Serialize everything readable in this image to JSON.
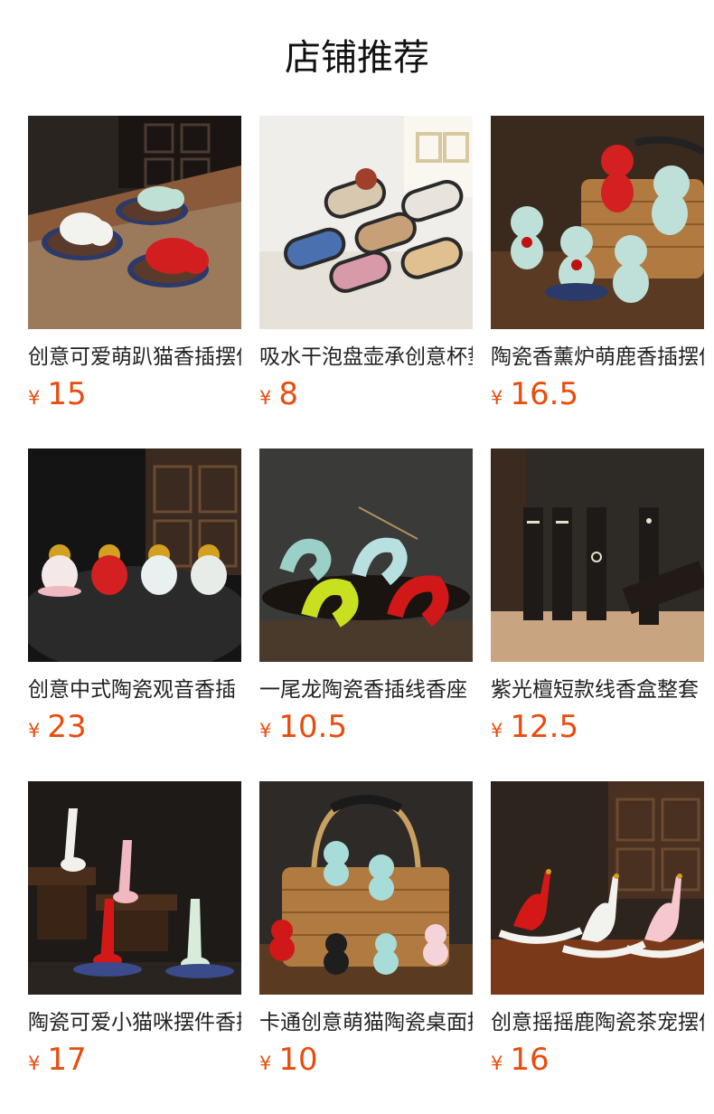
{
  "section": {
    "title": "店铺推荐"
  },
  "currency_symbol": "¥",
  "products": [
    {
      "name": "创意可爱萌趴猫香插摆件",
      "price": "15",
      "image_icon": "ceramic-cats-incense-holder"
    },
    {
      "name": "吸水干泡盘壶承创意杯垫",
      "price": "8",
      "image_icon": "painted-tea-trays"
    },
    {
      "name": "陶瓷香薰炉萌鹿香插摆件",
      "price": "16.5",
      "image_icon": "ceramic-deer-figurines"
    },
    {
      "name": "创意中式陶瓷观音香插",
      "price": "23",
      "image_icon": "ceramic-guanyin-figurines"
    },
    {
      "name": "一尾龙陶瓷香插线香座",
      "price": "10.5",
      "image_icon": "ceramic-dragon-incense-holders"
    },
    {
      "name": "紫光檀短款线香盒整套",
      "price": "12.5",
      "image_icon": "wooden-incense-boxes"
    },
    {
      "name": "陶瓷可爱小猫咪摆件香插",
      "price": "17",
      "image_icon": "ceramic-kittens-on-stands"
    },
    {
      "name": "卡通创意萌猫陶瓷桌面摆件",
      "price": "10",
      "image_icon": "ceramic-cats-with-basket"
    },
    {
      "name": "创意摇摇鹿陶瓷茶宠摆件",
      "price": "16",
      "image_icon": "rocking-deer-figurines"
    }
  ]
}
